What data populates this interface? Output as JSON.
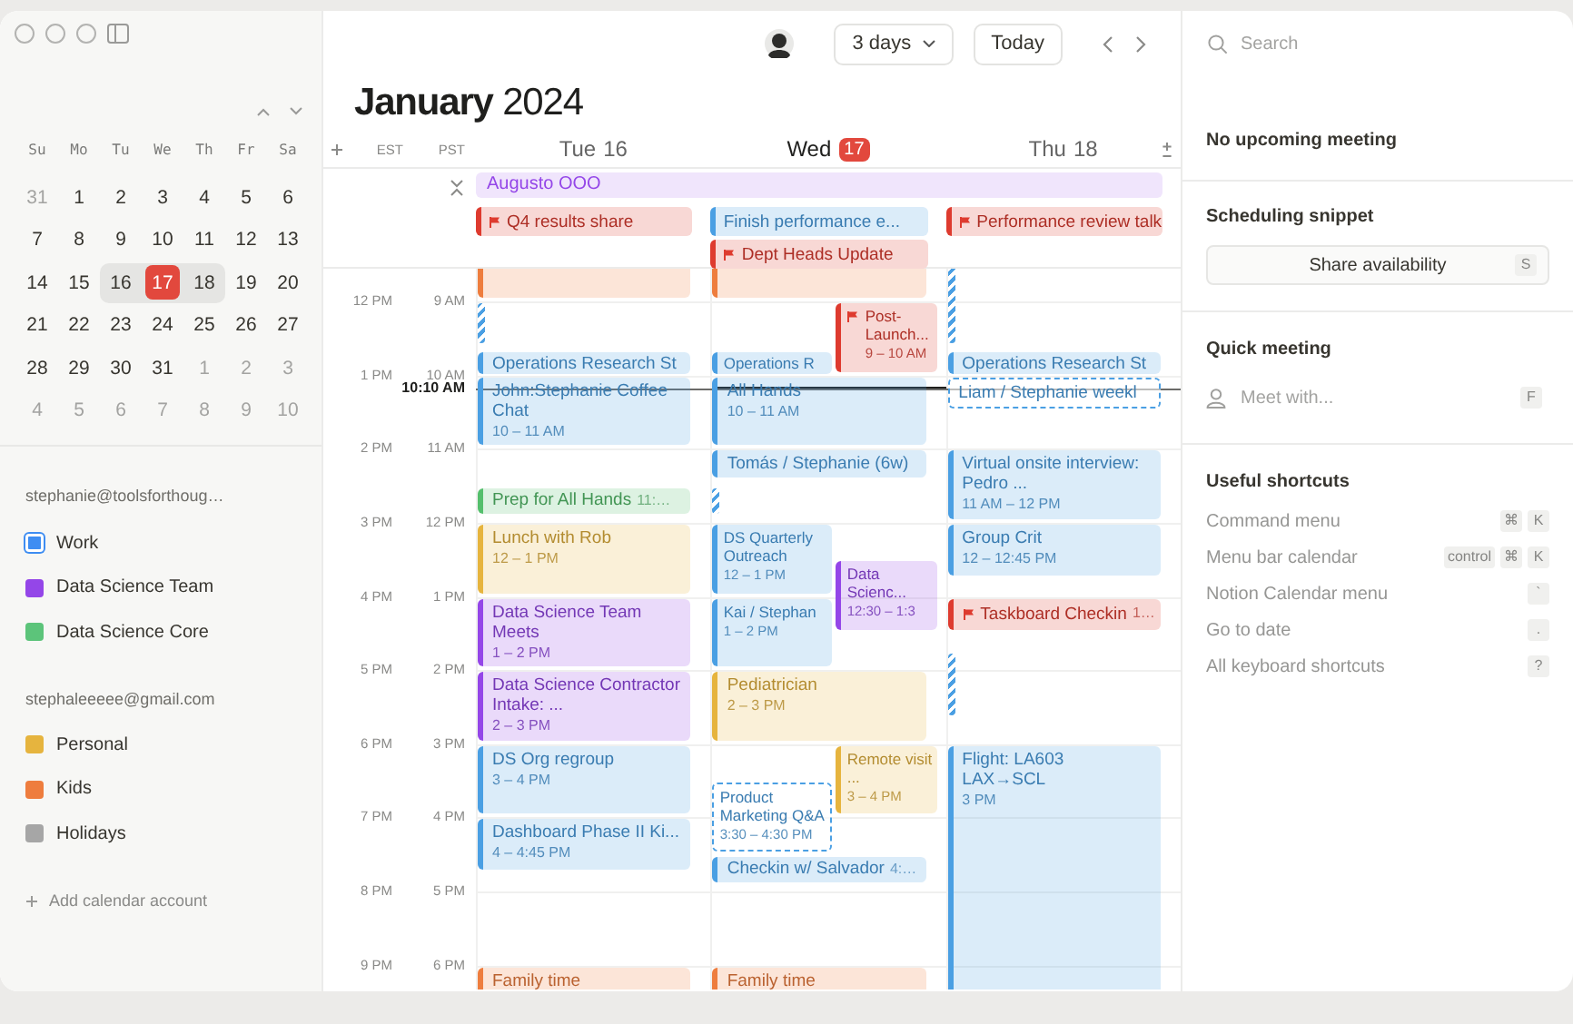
{
  "sidebar": {
    "mini_calendar": {
      "weekdays": [
        "Su",
        "Mo",
        "Tu",
        "We",
        "Th",
        "Fr",
        "Sa"
      ],
      "weeks": [
        [
          {
            "day": "31",
            "muted": true,
            "selected": false,
            "today": false
          },
          {
            "day": "1",
            "muted": false,
            "selected": false,
            "today": false
          },
          {
            "day": "2",
            "muted": false,
            "selected": false,
            "today": false
          },
          {
            "day": "3",
            "muted": false,
            "selected": false,
            "today": false
          },
          {
            "day": "4",
            "muted": false,
            "selected": false,
            "today": false
          },
          {
            "day": "5",
            "muted": false,
            "selected": false,
            "today": false
          },
          {
            "day": "6",
            "muted": false,
            "selected": false,
            "today": false
          }
        ],
        [
          {
            "day": "7",
            "muted": false,
            "selected": false,
            "today": false
          },
          {
            "day": "8",
            "muted": false,
            "selected": false,
            "today": false
          },
          {
            "day": "9",
            "muted": false,
            "selected": false,
            "today": false
          },
          {
            "day": "10",
            "muted": false,
            "selected": false,
            "today": false
          },
          {
            "day": "11",
            "muted": false,
            "selected": false,
            "today": false
          },
          {
            "day": "12",
            "muted": false,
            "selected": false,
            "today": false
          },
          {
            "day": "13",
            "muted": false,
            "selected": false,
            "today": false
          }
        ],
        [
          {
            "day": "14",
            "muted": false,
            "selected": false,
            "today": false
          },
          {
            "day": "15",
            "muted": false,
            "selected": false,
            "today": false
          },
          {
            "day": "16",
            "muted": false,
            "selected": true,
            "today": false
          },
          {
            "day": "17",
            "muted": false,
            "selected": true,
            "today": true
          },
          {
            "day": "18",
            "muted": false,
            "selected": true,
            "today": false
          },
          {
            "day": "19",
            "muted": false,
            "selected": false,
            "today": false
          },
          {
            "day": "20",
            "muted": false,
            "selected": false,
            "today": false
          }
        ],
        [
          {
            "day": "21",
            "muted": false,
            "selected": false,
            "today": false
          },
          {
            "day": "22",
            "muted": false,
            "selected": false,
            "today": false
          },
          {
            "day": "23",
            "muted": false,
            "selected": false,
            "today": false
          },
          {
            "day": "24",
            "muted": false,
            "selected": false,
            "today": false
          },
          {
            "day": "25",
            "muted": false,
            "selected": false,
            "today": false
          },
          {
            "day": "26",
            "muted": false,
            "selected": false,
            "today": false
          },
          {
            "day": "27",
            "muted": false,
            "selected": false,
            "today": false
          }
        ],
        [
          {
            "day": "28",
            "muted": false,
            "selected": false,
            "today": false
          },
          {
            "day": "29",
            "muted": false,
            "selected": false,
            "today": false
          },
          {
            "day": "30",
            "muted": false,
            "selected": false,
            "today": false
          },
          {
            "day": "31",
            "muted": false,
            "selected": false,
            "today": false
          },
          {
            "day": "1",
            "muted": true,
            "selected": false,
            "today": false
          },
          {
            "day": "2",
            "muted": true,
            "selected": false,
            "today": false
          },
          {
            "day": "3",
            "muted": true,
            "selected": false,
            "today": false
          }
        ],
        [
          {
            "day": "4",
            "muted": true,
            "selected": false,
            "today": false
          },
          {
            "day": "5",
            "muted": true,
            "selected": false,
            "today": false
          },
          {
            "day": "6",
            "muted": true,
            "selected": false,
            "today": false
          },
          {
            "day": "7",
            "muted": true,
            "selected": false,
            "today": false
          },
          {
            "day": "8",
            "muted": true,
            "selected": false,
            "today": false
          },
          {
            "day": "9",
            "muted": true,
            "selected": false,
            "today": false
          },
          {
            "day": "10",
            "muted": true,
            "selected": false,
            "today": false
          }
        ]
      ]
    },
    "accounts": [
      {
        "email": "stephanie@toolsforthoug…",
        "calendars": [
          {
            "name": "Work",
            "color": "#3e8df2",
            "focused": true
          },
          {
            "name": "Data Science Team",
            "color": "#9446e8",
            "focused": false
          },
          {
            "name": "Data Science Core",
            "color": "#5cc47a",
            "focused": false
          }
        ]
      },
      {
        "email": "stephaleeeee@gmail.com",
        "calendars": [
          {
            "name": "Personal",
            "color": "#e6b43e",
            "focused": false
          },
          {
            "name": "Kids",
            "color": "#ee7d3e",
            "focused": false
          },
          {
            "name": "Holidays",
            "color": "#a6a6a6",
            "focused": false
          }
        ]
      }
    ],
    "add_account": "Add calendar account"
  },
  "main": {
    "view": "3 days",
    "today_button": "Today",
    "title": "**January** 2024",
    "zones": [
      "EST",
      "PST"
    ],
    "hours": [
      {
        "est": "12 PM",
        "pst": "9 AM"
      },
      {
        "est": "1 PM",
        "pst": "10 AM"
      },
      {
        "est": "2 PM",
        "pst": "11 AM"
      },
      {
        "est": "3 PM",
        "pst": "12 PM"
      },
      {
        "est": "4 PM",
        "pst": "1 PM"
      },
      {
        "est": "5 PM",
        "pst": "2 PM"
      },
      {
        "est": "6 PM",
        "pst": "3 PM"
      },
      {
        "est": "7 PM",
        "pst": "4 PM"
      },
      {
        "est": "8 PM",
        "pst": "5 PM"
      },
      {
        "est": "9 PM",
        "pst": "6 PM"
      }
    ],
    "now": {
      "label": "10:10 AM"
    },
    "banner": {
      "title": "Augusto OOO",
      "color": "#9446e8"
    },
    "days": [
      {
        "weekday": "Tue",
        "date": "16",
        "today": false,
        "all_day": [
          {
            "title": "Q4 results share",
            "color": "#de3b2f",
            "marker": true
          }
        ],
        "events": [
          {
            "kind": "event",
            "color": "#ee7d3e"
          },
          {
            "kind": "buffer",
            "color": "#4a9fe3"
          },
          {
            "kind": "event",
            "color": "#4a9fe3",
            "title": "Operations Research St"
          },
          {
            "kind": "event",
            "color": "#4a9fe3",
            "title": "John:Stephanie Coffee Chat",
            "time": "10 – 11 AM"
          },
          {
            "kind": "event",
            "color": "#54bf6c",
            "title": "Prep for All Hands",
            "time": "11:…"
          },
          {
            "kind": "event",
            "color": "#e6b43e",
            "title": "Lunch with Rob",
            "time": "12 – 1 PM"
          },
          {
            "kind": "event",
            "color": "#9446e8",
            "title": "Data Science Team Meets",
            "time": "1 – 2 PM"
          },
          {
            "kind": "event",
            "color": "#9446e8",
            "title": "Data Science Contractor Intake: ...",
            "time": "2 – 3 PM"
          },
          {
            "kind": "event",
            "color": "#4a9fe3",
            "title": "DS Org regroup",
            "time": "3 – 4 PM"
          },
          {
            "kind": "event",
            "color": "#4a9fe3",
            "title": "Dashboard Phase II Ki...",
            "time": "4 – 4:45 PM"
          },
          {
            "kind": "event",
            "color": "#ee7d3e",
            "title": "Family time"
          }
        ]
      },
      {
        "weekday": "Wed",
        "date": "17",
        "today": true,
        "all_day": [
          {
            "title": "Finish performance e...",
            "color": "#4a9fe3",
            "marker": false
          },
          {
            "title": "Dept Heads Update",
            "color": "#de3b2f",
            "marker": true
          }
        ],
        "events": [
          {
            "kind": "event",
            "color": "#ee7d3e"
          },
          {
            "kind": "event",
            "color": "#4a9fe3",
            "title": "Operations R",
            "overlapped": true
          },
          {
            "kind": "event",
            "color": "#de3b2f",
            "title": "Post-Launch...",
            "time": "9 – 10 AM",
            "overlapping": true,
            "marker": true
          },
          {
            "kind": "event",
            "color": "#4a9fe3",
            "title": "All Hands",
            "time": "10 – 11 AM"
          },
          {
            "kind": "event",
            "color": "#4a9fe3",
            "title": "Tomás / Stephanie (6w)"
          },
          {
            "kind": "buffer",
            "color": "#4a9fe3"
          },
          {
            "kind": "event",
            "color": "#4a9fe3",
            "title": "DS Quarterly Outreach",
            "time": "12 – 1 PM",
            "overlapped": true
          },
          {
            "kind": "event",
            "color": "#4a9fe3",
            "title": "Kai / Stephan",
            "time": "1 – 2 PM",
            "overlapped": true
          },
          {
            "kind": "event",
            "color": "#9446e8",
            "title": "Data Scienc...",
            "time": "12:30 – 1:3",
            "overlapping": true
          },
          {
            "kind": "event",
            "color": "#e6b43e",
            "title": "Pediatrician",
            "time": "2 – 3 PM"
          },
          {
            "kind": "tentative",
            "color": "#4a9fe3",
            "title": "Product Marketing Q&A",
            "time": "3:30 – 4:30 PM",
            "overlapped": true
          },
          {
            "kind": "event",
            "color": "#e6b43e",
            "title": "Remote visit ...",
            "time": "3 – 4 PM",
            "overlapping": true
          },
          {
            "kind": "event",
            "color": "#4a9fe3",
            "title": "Checkin w/ Salvador",
            "time": "4:…"
          },
          {
            "kind": "event",
            "color": "#ee7d3e",
            "title": "Family time"
          }
        ]
      },
      {
        "weekday": "Thu",
        "date": "18",
        "today": false,
        "all_day": [
          {
            "title": "Performance review talk",
            "color": "#de3b2f",
            "marker": true
          }
        ],
        "events": [
          {
            "kind": "buffer",
            "color": "#4a9fe3"
          },
          {
            "kind": "event",
            "color": "#4a9fe3",
            "title": "Operations Research St"
          },
          {
            "kind": "tentative",
            "color": "#4a9fe3",
            "title": "Liam / Stephanie weekl"
          },
          {
            "kind": "event",
            "color": "#4a9fe3",
            "title": "Virtual onsite interview: Pedro ...",
            "time": "11 AM – 12 PM"
          },
          {
            "kind": "event",
            "color": "#4a9fe3",
            "title": "Group Crit",
            "time": "12 – 12:45 PM"
          },
          {
            "kind": "event",
            "color": "#de3b2f",
            "title": "Taskboard Checkin",
            "time": "1…",
            "marker": true
          },
          {
            "kind": "buffer",
            "color": "#4a9fe3"
          },
          {
            "kind": "event",
            "color": "#4a9fe3",
            "title": "Flight: LA603\nLAX→SCL",
            "time": "3 PM"
          }
        ]
      }
    ]
  },
  "panel": {
    "search": {
      "placeholder": "Search"
    },
    "upcoming": "No upcoming meeting",
    "snippet": {
      "heading": "Scheduling snippet",
      "button": "Share availability",
      "key": "S"
    },
    "quick": {
      "heading": "Quick meeting",
      "placeholder": "Meet with...",
      "key": "F"
    },
    "shortcuts": {
      "heading": "Useful shortcuts",
      "items": [
        {
          "label": "Command menu",
          "keys": [
            "⌘",
            "K"
          ]
        },
        {
          "label": "Menu bar calendar",
          "keys": [
            "control",
            "⌘",
            "K"
          ]
        },
        {
          "label": "Notion Calendar menu",
          "keys": [
            "`"
          ]
        },
        {
          "label": "Go to date",
          "keys": [
            "."
          ]
        },
        {
          "label": "All keyboard shortcuts",
          "keys": [
            "?"
          ]
        }
      ]
    }
  }
}
